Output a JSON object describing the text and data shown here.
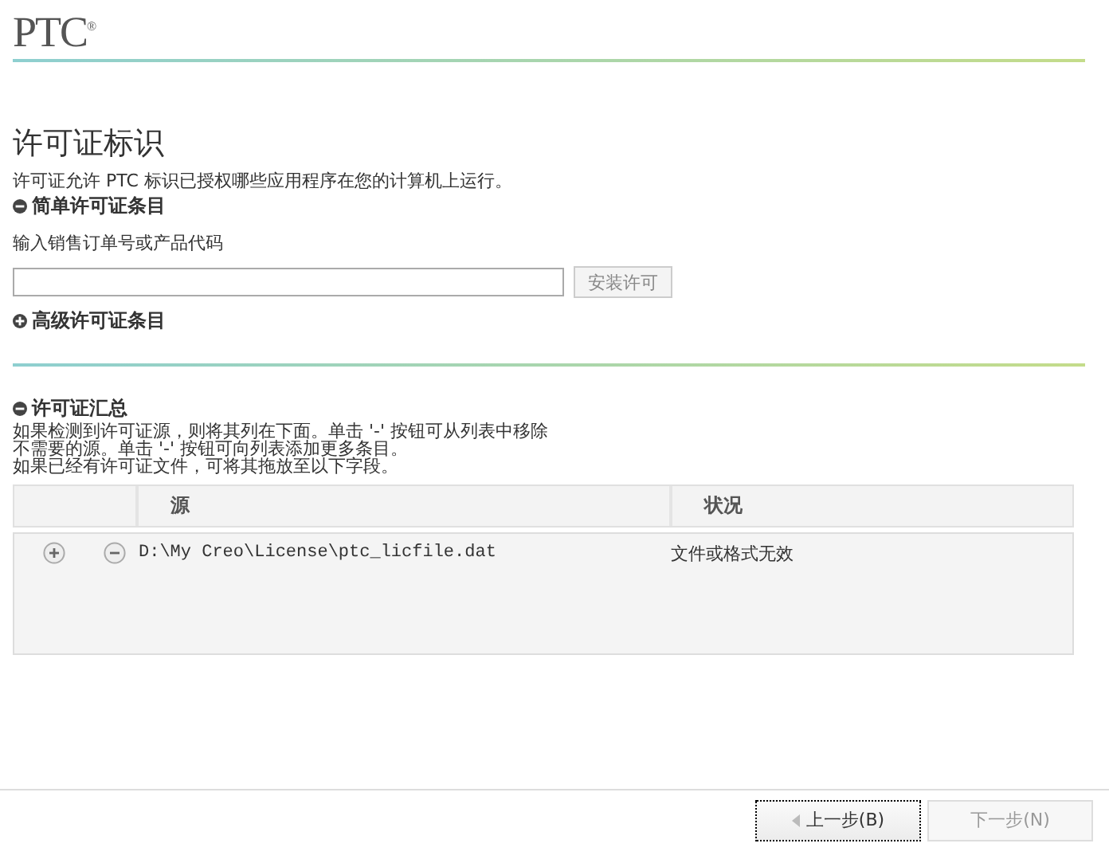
{
  "logo": "PTC$^{®}$",
  "page_title": "许可证标识",
  "intro": "许可证允许 PTC 标识已授权哪些应用程序在您的计算机上运行。",
  "simple_section": {
    "title": "简单许可证条目",
    "expanded": true,
    "field_label": "输入销售订单号或产品代码",
    "install_button": "安装许可"
  },
  "advanced_section": {
    "title": "高级许可证条目",
    "expanded": false
  },
  "summary_section": {
    "title": "许可证汇总",
    "expanded": true,
    "description": [
      "如果检测到许可证源，则将其列在下面。单击 '-' 按钮可从列表中移除",
      "不需要的源。单击 '-' 按钮可向列表添加更多条目。",
      "如果已经有许可证文件，可将其拖放至以下字段。"
    ]
  },
  "table": {
    "columns": [
      "源",
      "状况"
    ],
    "rows": [
      {
        "source": "D:\\My Creo\\License\\ptc_licfile.dat",
        "status": "文件或格式无效"
      }
    ]
  },
  "buttons": [
    {
      "label": "上一步(B)",
      "disabled": false,
      "focused": true
    },
    {
      "label": "下一步(N)",
      "disabled": true,
      "focused": false
    }
  ]
}
